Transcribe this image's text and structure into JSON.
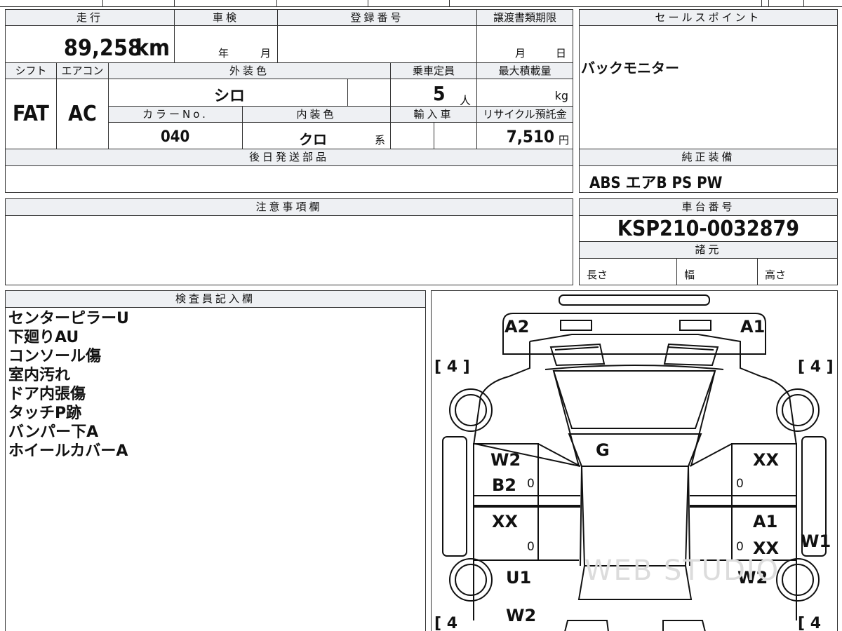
{
  "mileage": {
    "label": "走行",
    "value": "89,258",
    "unit": "km"
  },
  "shaken": {
    "label": "車検",
    "year_unit": "年",
    "month_unit": "月"
  },
  "registration_number": {
    "label": "登録番号",
    "value": ""
  },
  "transfer_deadline": {
    "label": "譲渡書類期限",
    "month_unit": "月",
    "day_unit": "日"
  },
  "sales_point": {
    "label": "セールスポイント",
    "text": "バックモニター"
  },
  "shift": {
    "label": "シフト",
    "value": "FAT"
  },
  "aircon": {
    "label": "エアコン",
    "value": "AC"
  },
  "exterior_color": {
    "label": "外装色",
    "value": "シロ"
  },
  "capacity": {
    "label": "乗車定員",
    "value": "5",
    "unit": "人"
  },
  "max_load": {
    "label": "最大積載量",
    "unit": "kg"
  },
  "color_no": {
    "label": "カラーNo.",
    "value": "040"
  },
  "interior_color": {
    "label": "内装色",
    "value": "クロ",
    "suffix": "系"
  },
  "import": {
    "label": "輸入車"
  },
  "recycle_fee": {
    "label": "リサイクル預託金",
    "value": "7,510",
    "unit": "円"
  },
  "later_parts": {
    "label": "後日発送部品"
  },
  "standard_equipment": {
    "label": "純正装備",
    "value": "ABS エアB PS PW"
  },
  "caution": {
    "label": "注意事項欄"
  },
  "chassis_number": {
    "label": "車台番号",
    "value": "KSP210-0032879"
  },
  "specs": {
    "label": "諸元",
    "length": "長さ",
    "width": "幅",
    "height": "高さ"
  },
  "inspector_notes": {
    "label": "検査員記入欄",
    "lines": [
      "センターピラーU",
      "下廻りAU",
      "コンソール傷",
      "室内汚れ",
      "ドア内張傷",
      "タッチP跡",
      "バンパー下A",
      "ホイールカバーA"
    ]
  },
  "diagram": {
    "tire_marks": [
      "[ 4 ]",
      "[ 4 ]",
      "[ 4",
      "[ 4"
    ],
    "labels": {
      "front_left": "A2",
      "front_right": "A1",
      "hood": "G",
      "fl_door_1": "W2",
      "fl_door_2": "B2",
      "fr_door": "XX",
      "rl_door": "XX",
      "rr_door_1": "A1",
      "rr_door_2": "XX",
      "right_quarter": "W1",
      "rear_left_1": "U1",
      "rear_left_2": "W2",
      "rear_right": "W2"
    },
    "zeros": [
      "0",
      "0",
      "0",
      "0"
    ],
    "watermark": "WEB STUDIO"
  }
}
